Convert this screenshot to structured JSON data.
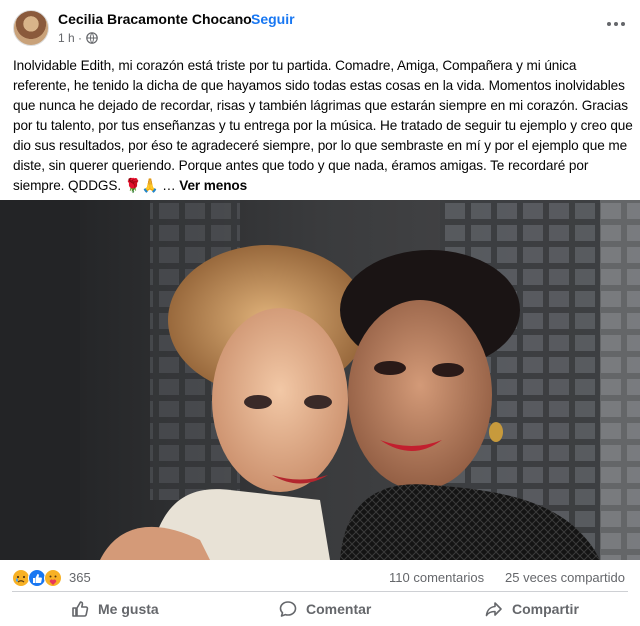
{
  "post": {
    "author": "Cecilia Bracamonte Chocano",
    "separator": "·",
    "follow_label": "Seguir",
    "time": "1 h ·",
    "text": "Inolvidable Edith, mi corazón está triste por tu partida. Comadre, Amiga, Compañera y mi única referente, he tenido la dicha de que hayamos sido todas estas cosas en la vida. Momentos inolvidables que nunca he dejado de recordar, risas y también lágrimas que estarán siempre en mi corazón. Gracias por tu talento, por tus enseñanzas y tu entrega por la música. He tratado de seguir tu ejemplo y creo que dio sus resultados, por éso te agradeceré siempre, por lo que sembraste en mí y por el ejemplo que me diste, sin querer queriendo. Porque antes que todo y que nada, éramos amigas. Te recordaré por siempre. QDDGS.",
    "emojis": "🌹🙏",
    "see_less_label": "Ver menos"
  },
  "stats": {
    "reactions_count": "365",
    "reaction_icons": [
      "sad-icon",
      "like-icon",
      "care-icon"
    ],
    "comments": "110 comentarios",
    "shares": "25 veces compartido"
  },
  "actions": {
    "like_label": "Me gusta",
    "comment_label": "Comentar",
    "share_label": "Compartir"
  },
  "colors": {
    "link_blue": "#1877f2",
    "secondary_text": "#65676b",
    "like_blue": "#1877f2",
    "sad_yellow": "#f7b125"
  }
}
